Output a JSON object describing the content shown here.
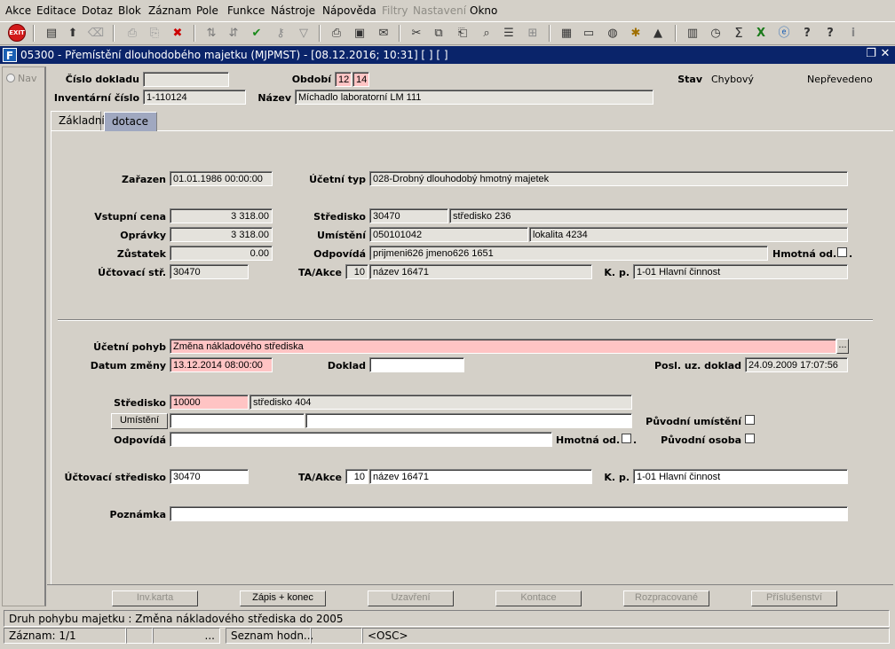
{
  "menu": [
    "Akce",
    "Editace",
    "Dotaz",
    "Blok",
    "Záznam",
    "Pole",
    "Funkce",
    "Nástroje",
    "Nápověda",
    "Filtry",
    "Nastavení",
    "Okno"
  ],
  "window": {
    "title": "05300 - Přemístění dlouhodobého majetku (MJPMST) - [08.12.2016; 10:31] [ ] [ ]",
    "icon_letter": "F"
  },
  "nav": {
    "label": "Nav"
  },
  "header": {
    "cislo_dokladu_label": "Číslo dokladu",
    "cislo_dokladu_value": "",
    "obdobi_label": "Období",
    "obdobi_month": "12",
    "obdobi_year": "14",
    "stav_label": "Stav",
    "stav_value": "Chybový",
    "neprevedeno": "Nepřevedeno",
    "inventarni_cislo_label": "Inventární číslo",
    "inventarni_cislo_value": "1-110124",
    "nazev_label": "Název",
    "nazev_value": "Míchadlo laboratorní LM 111"
  },
  "tabs": [
    {
      "label": "Základní"
    },
    {
      "label": "dotace"
    }
  ],
  "form": {
    "zarazen_label": "Zařazen",
    "zarazen_value": "01.01.1986 00:00:00",
    "ucetni_typ_label": "Účetní typ",
    "ucetni_typ_value": "028-Drobný dlouhodobý hmotný majetek",
    "vstupni_cena_label": "Vstupní cena",
    "vstupni_cena_value": "3 318.00",
    "stredisko_label": "Středisko",
    "stredisko_code": "30470",
    "stredisko_name": "středisko 236",
    "opravky_label": "Oprávky",
    "opravky_value": "3 318.00",
    "umisteni_label": "Umístění",
    "umisteni_code": "050101042",
    "umisteni_name": "lokalita 4234",
    "zustatek_label": "Zůstatek",
    "zustatek_value": "0.00",
    "odpovida_label": "Odpovídá",
    "odpovida_value": "prijmeni626 jmeno626 1651",
    "hmotna_od_label": "Hmotná od.",
    "uctovaci_str_label": "Účtovací stř.",
    "uctovaci_str_value": "30470",
    "ta_akce_label": "TA/Akce",
    "ta_akce_num": "10",
    "ta_akce_name": "název 16471",
    "kp_label": "K. p.",
    "kp_value": "1-01 Hlavní činnost"
  },
  "lower": {
    "ucetni_pohyb_label": "Účetní pohyb",
    "ucetni_pohyb_value": "Změna nákladového střediska",
    "lov_button": "...",
    "datum_zmeny_label": "Datum změny",
    "datum_zmeny_value": "13.12.2014 08:00:00",
    "doklad_label": "Doklad",
    "doklad_value": "",
    "posl_uz_doklad_label": "Posl. uz. doklad",
    "posl_uz_doklad_value": "24.09.2009 17:07:56",
    "stredisko_label": "Středisko",
    "stredisko_code": "10000",
    "stredisko_name": "středisko 404",
    "umisteni_button": "Umístění",
    "umisteni_code": "",
    "umisteni_name": "",
    "puvodni_umisteni_label": "Původní umístění",
    "odpovida_label": "Odpovídá",
    "odpovida_value": "",
    "hmotna_od_label": "Hmotná od.",
    "puvodni_osoba_label": "Původní osoba",
    "uctovaci_stredisko_label": "Účtovací středisko",
    "uctovaci_stredisko_value": "30470",
    "ta_akce_label": "TA/Akce",
    "ta_akce_num": "10",
    "ta_akce_name": "název 16471",
    "kp_label": "K. p.",
    "kp_value": "1-01 Hlavní činnost",
    "poznamka_label": "Poznámka",
    "poznamka_value": ""
  },
  "buttons": {
    "inv_karta": "Inv.karta",
    "zapis_konec": "Zápis + konec",
    "uzavreni": "Uzavření",
    "kontace": "Kontace",
    "rozpracovane": "Rozpracované",
    "prislusenstvi": "Příslušenství"
  },
  "status": {
    "hint": "Druh pohybu majetku : Změna nákladového střediska do 2005",
    "zaznam": "Záznam: 1/1",
    "dots": "...",
    "seznam": "Seznam hodn...",
    "osc": "<OSC>"
  }
}
